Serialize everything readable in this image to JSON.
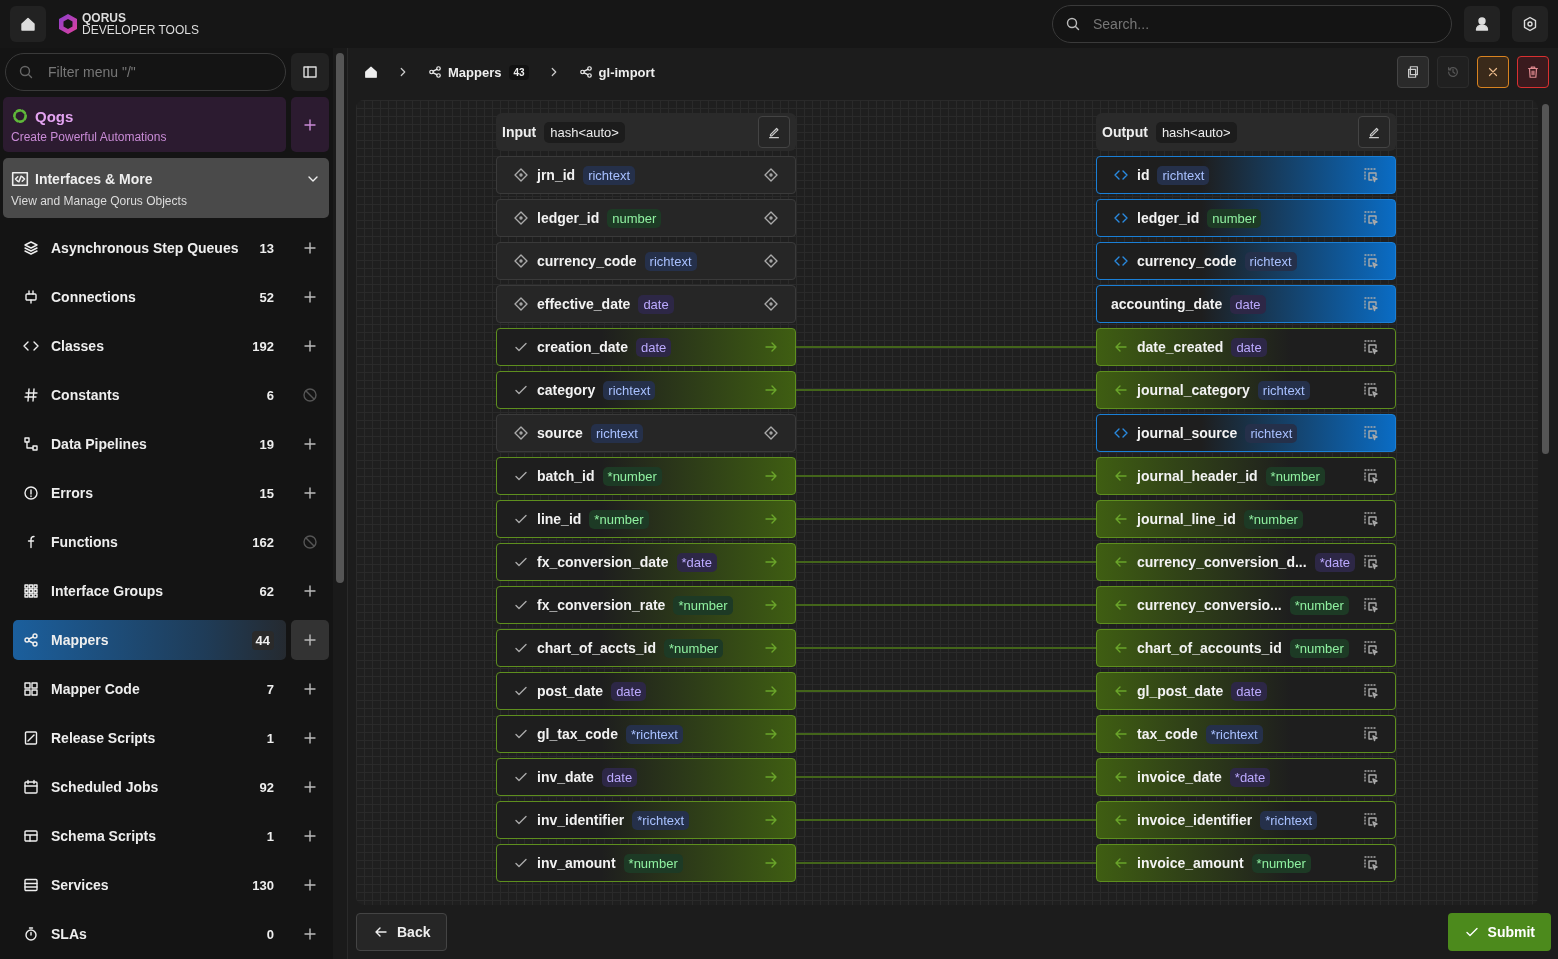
{
  "topbar": {
    "logo_line1": "QORUS",
    "logo_line2": "DEVELOPER TOOLS",
    "search": {
      "placeholder": "Search..."
    }
  },
  "sidebar": {
    "filter": {
      "placeholder": "Filter menu \"/\""
    },
    "qogs": {
      "title": "Qogs",
      "subtitle": "Create Powerful Automations"
    },
    "section": {
      "title": "Interfaces & More",
      "subtitle": "View and Manage Qorus Objects",
      "expanded": true
    },
    "items": [
      {
        "label": "Asynchronous Step Queues",
        "count": "13",
        "disabled": false,
        "selected": false
      },
      {
        "label": "Connections",
        "count": "52",
        "disabled": false,
        "selected": false
      },
      {
        "label": "Classes",
        "count": "192",
        "disabled": false,
        "selected": false
      },
      {
        "label": "Constants",
        "count": "6",
        "disabled": true,
        "selected": false
      },
      {
        "label": "Data Pipelines",
        "count": "19",
        "disabled": false,
        "selected": false
      },
      {
        "label": "Errors",
        "count": "15",
        "disabled": false,
        "selected": false
      },
      {
        "label": "Functions",
        "count": "162",
        "disabled": true,
        "selected": false
      },
      {
        "label": "Interface Groups",
        "count": "62",
        "disabled": false,
        "selected": false
      },
      {
        "label": "Mappers",
        "count": "44",
        "disabled": false,
        "selected": true
      },
      {
        "label": "Mapper Code",
        "count": "7",
        "disabled": false,
        "selected": false
      },
      {
        "label": "Release Scripts",
        "count": "1",
        "disabled": false,
        "selected": false
      },
      {
        "label": "Scheduled Jobs",
        "count": "92",
        "disabled": false,
        "selected": false
      },
      {
        "label": "Schema Scripts",
        "count": "1",
        "disabled": false,
        "selected": false
      },
      {
        "label": "Services",
        "count": "130",
        "disabled": false,
        "selected": false
      },
      {
        "label": "SLAs",
        "count": "0",
        "disabled": false,
        "selected": false
      }
    ]
  },
  "breadcrumb": [
    {
      "label": "Mappers",
      "count": "43"
    },
    {
      "label": "gl-import"
    }
  ],
  "toolbar": {
    "history_disabled": true
  },
  "mapper": {
    "input": {
      "title": "Input",
      "type": "hash<auto>"
    },
    "output": {
      "title": "Output",
      "type": "hash<auto>"
    },
    "rows": [
      {
        "input": {
          "name": "jrn_id",
          "type": {
            "label": "richtext",
            "kind": "richtext"
          },
          "mapped": false
        },
        "output": {
          "name": "id",
          "type": {
            "label": "richtext",
            "kind": "richtext"
          },
          "kind": "coded"
        }
      },
      {
        "input": {
          "name": "ledger_id",
          "type": {
            "label": "number",
            "kind": "number"
          },
          "mapped": false
        },
        "output": {
          "name": "ledger_id",
          "type": {
            "label": "number",
            "kind": "number"
          },
          "kind": "coded"
        }
      },
      {
        "input": {
          "name": "currency_code",
          "type": {
            "label": "richtext",
            "kind": "richtext"
          },
          "mapped": false
        },
        "output": {
          "name": "currency_code",
          "type": {
            "label": "richtext",
            "kind": "richtext"
          },
          "kind": "coded"
        }
      },
      {
        "input": {
          "name": "effective_date",
          "type": {
            "label": "date",
            "kind": "date"
          },
          "mapped": false
        },
        "output": {
          "name": "accounting_date",
          "type": {
            "label": "date",
            "kind": "date"
          },
          "kind": "preset"
        }
      },
      {
        "input": {
          "name": "creation_date",
          "type": {
            "label": "date",
            "kind": "date"
          },
          "mapped": true
        },
        "output": {
          "name": "date_created",
          "type": {
            "label": "date",
            "kind": "date"
          },
          "kind": "mapped"
        }
      },
      {
        "input": {
          "name": "category",
          "type": {
            "label": "richtext",
            "kind": "richtext"
          },
          "mapped": true
        },
        "output": {
          "name": "journal_category",
          "type": {
            "label": "richtext",
            "kind": "richtext"
          },
          "kind": "mapped"
        }
      },
      {
        "input": {
          "name": "source",
          "type": {
            "label": "richtext",
            "kind": "richtext"
          },
          "mapped": false
        },
        "output": {
          "name": "journal_source",
          "type": {
            "label": "richtext",
            "kind": "richtext"
          },
          "kind": "coded"
        }
      },
      {
        "input": {
          "name": "batch_id",
          "type": {
            "label": "*number",
            "kind": "number"
          },
          "mapped": true
        },
        "output": {
          "name": "journal_header_id",
          "type": {
            "label": "*number",
            "kind": "number"
          },
          "kind": "mapped"
        }
      },
      {
        "input": {
          "name": "line_id",
          "type": {
            "label": "*number",
            "kind": "number"
          },
          "mapped": true
        },
        "output": {
          "name": "journal_line_id",
          "type": {
            "label": "*number",
            "kind": "number"
          },
          "kind": "mapped"
        }
      },
      {
        "input": {
          "name": "fx_conversion_date",
          "type": {
            "label": "*date",
            "kind": "date"
          },
          "mapped": true
        },
        "output": {
          "name": "currency_conversion_d...",
          "type": {
            "label": "*date",
            "kind": "date"
          },
          "kind": "mapped"
        }
      },
      {
        "input": {
          "name": "fx_conversion_rate",
          "type": {
            "label": "*number",
            "kind": "number"
          },
          "mapped": true
        },
        "output": {
          "name": "currency_conversio...",
          "type": {
            "label": "*number",
            "kind": "number"
          },
          "kind": "mapped"
        }
      },
      {
        "input": {
          "name": "chart_of_accts_id",
          "type": {
            "label": "*number",
            "kind": "number"
          },
          "mapped": true
        },
        "output": {
          "name": "chart_of_accounts_id",
          "type": {
            "label": "*number",
            "kind": "number"
          },
          "kind": "mapped"
        }
      },
      {
        "input": {
          "name": "post_date",
          "type": {
            "label": "date",
            "kind": "date"
          },
          "mapped": true
        },
        "output": {
          "name": "gl_post_date",
          "type": {
            "label": "date",
            "kind": "date"
          },
          "kind": "mapped"
        }
      },
      {
        "input": {
          "name": "gl_tax_code",
          "type": {
            "label": "*richtext",
            "kind": "richtext"
          },
          "mapped": true
        },
        "output": {
          "name": "tax_code",
          "type": {
            "label": "*richtext",
            "kind": "richtext"
          },
          "kind": "mapped"
        }
      },
      {
        "input": {
          "name": "inv_date",
          "type": {
            "label": "date",
            "kind": "date"
          },
          "mapped": true
        },
        "output": {
          "name": "invoice_date",
          "type": {
            "label": "*date",
            "kind": "date"
          },
          "kind": "mapped"
        }
      },
      {
        "input": {
          "name": "inv_identifier",
          "type": {
            "label": "*richtext",
            "kind": "richtext"
          },
          "mapped": true
        },
        "output": {
          "name": "invoice_identifier",
          "type": {
            "label": "*richtext",
            "kind": "richtext"
          },
          "kind": "mapped"
        }
      },
      {
        "input": {
          "name": "inv_amount",
          "type": {
            "label": "*number",
            "kind": "number"
          },
          "mapped": true
        },
        "output": {
          "name": "invoice_amount",
          "type": {
            "label": "*number",
            "kind": "number"
          },
          "kind": "mapped"
        }
      }
    ]
  },
  "footer": {
    "back": "Back",
    "submit": "Submit"
  }
}
